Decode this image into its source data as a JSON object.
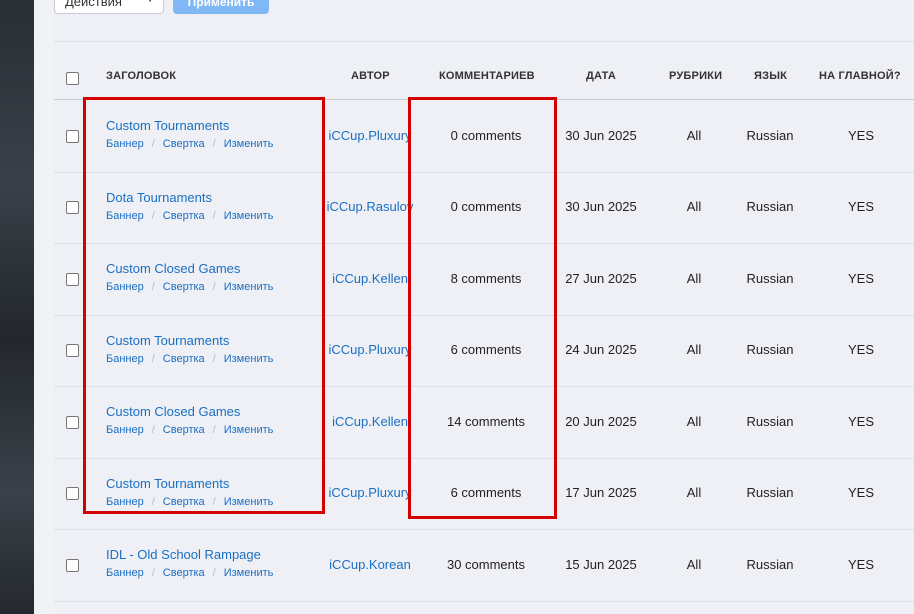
{
  "toolbar": {
    "bulk_actions_value": "Действия",
    "apply_label": "Применить"
  },
  "columns": {
    "title": "ЗАГОЛОВОК",
    "author": "АВТОР",
    "comments": "КОММЕНТАРИЕВ",
    "date": "ДАТА",
    "categories": "РУБРИКИ",
    "language": "ЯЗЫК",
    "on_main": "НА ГЛАВНОЙ?"
  },
  "row_actions": {
    "banner": "Баннер",
    "collapse": "Свертка",
    "edit": "Изменить",
    "separator": "/"
  },
  "rows": [
    {
      "title": "Custom Tournaments",
      "author": "iCCup.Pluxury",
      "comments": "0 comments",
      "date": "30 Jun 2025",
      "categories": "All",
      "language": "Russian",
      "on_main": "YES"
    },
    {
      "title": "Dota Tournaments",
      "author": "iCCup.Rasulov",
      "comments": "0 comments",
      "date": "30 Jun 2025",
      "categories": "All",
      "language": "Russian",
      "on_main": "YES"
    },
    {
      "title": "Custom Closed Games",
      "author": "iCCup.Kellen",
      "comments": "8 comments",
      "date": "27 Jun 2025",
      "categories": "All",
      "language": "Russian",
      "on_main": "YES"
    },
    {
      "title": "Custom Tournaments",
      "author": "iCCup.Pluxury",
      "comments": "6 comments",
      "date": "24 Jun 2025",
      "categories": "All",
      "language": "Russian",
      "on_main": "YES"
    },
    {
      "title": "Custom Closed Games",
      "author": "iCCup.Kellen",
      "comments": "14 comments",
      "date": "20 Jun 2025",
      "categories": "All",
      "language": "Russian",
      "on_main": "YES"
    },
    {
      "title": "Custom Tournaments",
      "author": "iCCup.Pluxury",
      "comments": "6 comments",
      "date": "17 Jun 2025",
      "categories": "All",
      "language": "Russian",
      "on_main": "YES"
    },
    {
      "title": "IDL - Old School Rampage",
      "author": "iCCup.Korean",
      "comments": "30 comments",
      "date": "15 Jun 2025",
      "categories": "All",
      "language": "Russian",
      "on_main": "YES"
    }
  ],
  "colors": {
    "link": "#1a6fc4",
    "highlight": "#d40000",
    "apply_button": "#7fb8f4"
  }
}
